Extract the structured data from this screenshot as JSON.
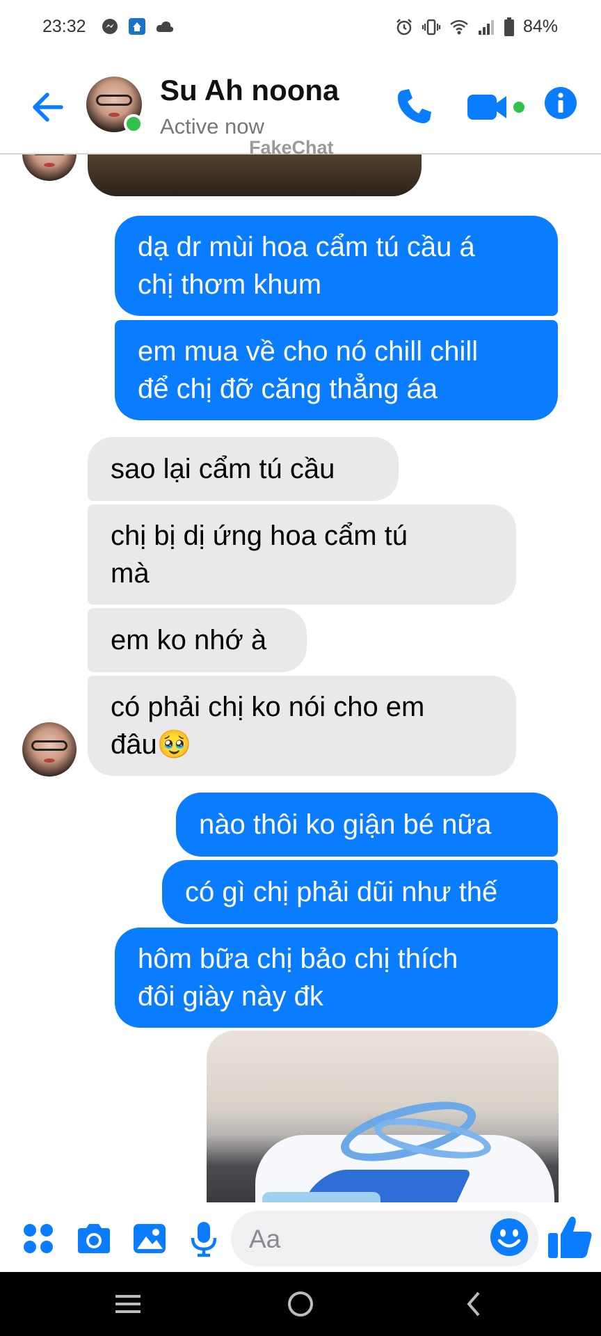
{
  "status_bar": {
    "time": "23:32",
    "battery": "84%"
  },
  "header": {
    "contact_name": "Su Ah noona",
    "contact_status": "Active now",
    "watermark": "FakeChat"
  },
  "colors": {
    "accent": "#0a7cff",
    "outgoing_bubble": "#0a7cff",
    "incoming_bubble": "#e9e9eb",
    "online": "#30c24b"
  },
  "messages": [
    {
      "direction": "out",
      "lines": [
        "dạ dr mùi hoa cẩm tú cầu á",
        "chị thơm khum"
      ]
    },
    {
      "direction": "out",
      "lines": [
        "em mua về cho nó chill chill",
        "để chị đỡ căng thẳng áa"
      ]
    },
    {
      "direction": "in",
      "lines": [
        "sao lại cẩm tú cầu"
      ]
    },
    {
      "direction": "in",
      "lines": [
        "chị bị dị ứng hoa cẩm tú",
        "mà"
      ]
    },
    {
      "direction": "in",
      "lines": [
        "em ko nhớ à"
      ]
    },
    {
      "direction": "in",
      "lines": [
        "có phải chị ko nói cho em",
        "đâu🥹"
      ]
    },
    {
      "direction": "out",
      "lines": [
        "nào thôi ko giận bé nữa"
      ]
    },
    {
      "direction": "out",
      "lines": [
        "có gì chị phải dũi như thế"
      ]
    },
    {
      "direction": "out",
      "lines": [
        "hôm bữa chị bảo chị thích",
        "đôi giày này đk"
      ]
    }
  ],
  "composer": {
    "placeholder": "Aa",
    "icons": [
      "menu-dots-icon",
      "camera-icon",
      "gallery-icon",
      "microphone-icon",
      "emoji-icon",
      "thumbs-up-icon"
    ]
  },
  "navbar": {
    "icons": [
      "recent-apps-icon",
      "home-icon",
      "back-icon"
    ]
  }
}
